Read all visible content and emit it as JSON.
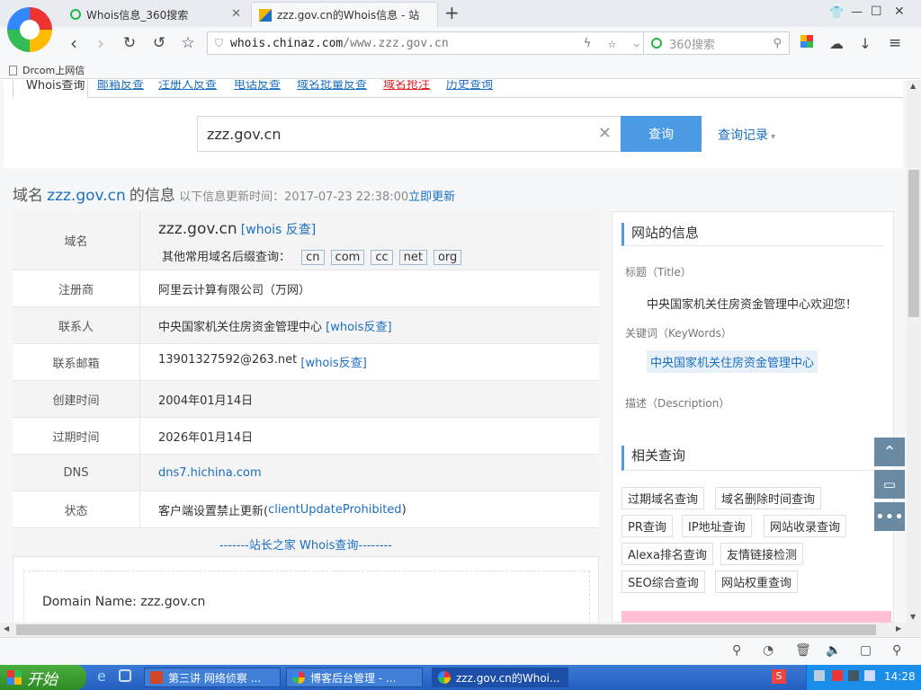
{
  "browser": {
    "tabs": [
      {
        "label": "Whois信息_360搜索",
        "active": false
      },
      {
        "label": "zzz.gov.cn的Whois信息 - 站",
        "active": true
      }
    ],
    "new_tab": "+",
    "url_host": "whois.chinaz.com",
    "url_path": "/www.zzz.gov.cn",
    "search_placeholder": "360搜索",
    "bookmark": "Drcom上网信",
    "window_buttons": [
      "—",
      "☐",
      "✕"
    ]
  },
  "page": {
    "subnav": [
      "Whois查询",
      "邮箱反查",
      "注册人反查",
      "电话反查",
      "域名批量反查",
      "域名抢注",
      "历史查询"
    ],
    "search": {
      "value": "zzz.gov.cn",
      "button": "查询",
      "history": "查询记录"
    },
    "heading": {
      "prefix": "域名",
      "domain": "zzz.gov.cn",
      "suffix": "的信息",
      "updated": "以下信息更新时间：2017-07-23 22:38:00",
      "refresh": "立即更新"
    },
    "rows": {
      "domain_label": "域名",
      "domain_value": "zzz.gov.cn",
      "domain_link": "[whois 反查]",
      "suffix_label": "其他常用域名后缀查询：",
      "suffixes": [
        "cn",
        "com",
        "cc",
        "net",
        "org"
      ],
      "registrar_label": "注册商",
      "registrar_value": "阿里云计算有限公司（万网）",
      "contact_label": "联系人",
      "contact_value": "中央国家机关住房资金管理中心",
      "contact_link": "[whois反查]",
      "email_label": "联系邮箱",
      "email_value": "13901327592@263.net",
      "email_link": "[whois反查]",
      "created_label": "创建时间",
      "created_value": "2004年01月14日",
      "expires_label": "过期时间",
      "expires_value": "2026年01月14日",
      "dns_label": "DNS",
      "dns_value": "dns7.hichina.com",
      "status_label": "状态",
      "status_value": "客户端设置禁止更新(",
      "status_code": "clientUpdateProhibited",
      "status_end": ")"
    },
    "whois_link": "-------站长之家 Whois查询--------",
    "raw": "Domain Name: zzz.gov.cn",
    "side": {
      "site_info_title": "网站的信息",
      "title_label": "标题（Title）",
      "title_value": "中央国家机关住房资金管理中心欢迎您！",
      "keywords_label": "关键词（KeyWords）",
      "keywords_value": "中央国家机关住房资金管理中心",
      "desc_label": "描述（Description）",
      "related_title": "相关查询",
      "related": [
        "过期域名查询",
        "域名删除时间查询",
        "PR查询",
        "IP地址查询",
        "网站收录查询",
        "Alexa排名查询",
        "友情链接检测",
        "SEO综合查询",
        "网站权重查询"
      ]
    }
  },
  "taskbar": {
    "start": "开始",
    "tasks": [
      "第三讲 网络侦察 ...",
      "博客后台管理 - ...",
      "zzz.gov.cn的Whoi..."
    ],
    "clock": "14:28"
  }
}
